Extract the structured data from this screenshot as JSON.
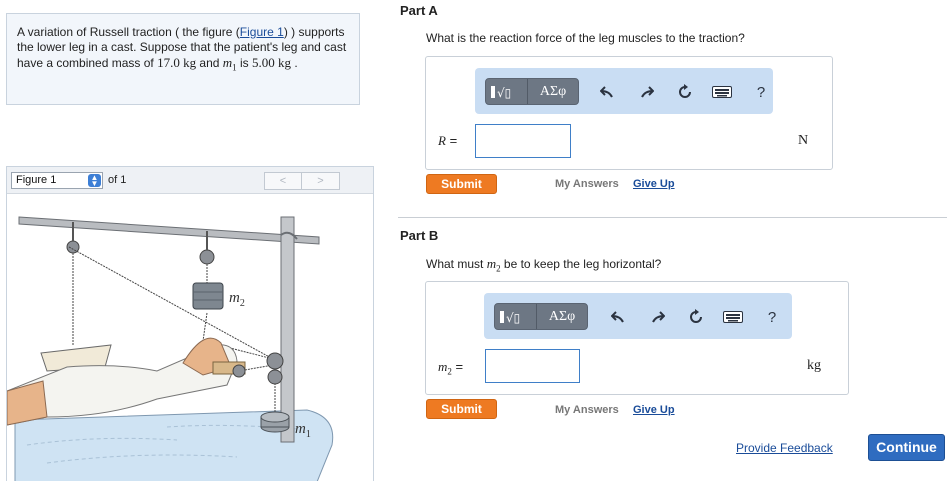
{
  "problem": {
    "text_1": "A variation of Russell traction ( the figure (",
    "figure_link": "Figure 1",
    "text_2": ") ) supports the lower leg in a cast. Suppose that the patient's leg and cast have a combined mass of ",
    "mass_value": "17.0 kg",
    "text_3": " and ",
    "m1_symbol": "m",
    "m1_sub": "1",
    "text_4": " is ",
    "m1_value": "5.00 kg",
    "text_5": " ."
  },
  "figure_panel": {
    "select_value": "Figure 1",
    "of_label": "of 1",
    "prev_glyph": "<",
    "next_glyph": ">",
    "labels": {
      "m2": "m",
      "m2_sub": "2",
      "m1": "m",
      "m1_sub": "1"
    }
  },
  "parts": [
    {
      "title": "Part A",
      "question": "What is the reaction force of the leg muscles to the traction?",
      "variable_symbol": "R",
      "variable_eq": "=",
      "unit": "N",
      "input_value": "",
      "submit_label": "Submit",
      "my_answers_label": "My Answers",
      "give_up_label": "Give Up"
    },
    {
      "title": "Part B",
      "question_pre": "What must ",
      "question_sym": "m",
      "question_sub": "2",
      "question_post": " be to keep the leg horizontal?",
      "variable_symbol": "m",
      "variable_sub": "2",
      "variable_eq": "=",
      "unit": "kg",
      "input_value": "",
      "submit_label": "Submit",
      "my_answers_label": "My Answers",
      "give_up_label": "Give Up"
    }
  ],
  "toolbar": {
    "templates_icon": "template-icon",
    "greek_label": "ΑΣφ",
    "undo_icon": "undo-icon",
    "redo_icon": "redo-icon",
    "reset_icon": "reset-icon",
    "keyboard_icon": "keyboard-icon",
    "help_label": "?"
  },
  "footer": {
    "feedback_label": "Provide Feedback",
    "continue_label": "Continue"
  },
  "colors": {
    "submit": "#ee7a22",
    "continue": "#2f6cc0",
    "link": "#1a4c99",
    "toolbar_bg": "#c9ddf3"
  }
}
